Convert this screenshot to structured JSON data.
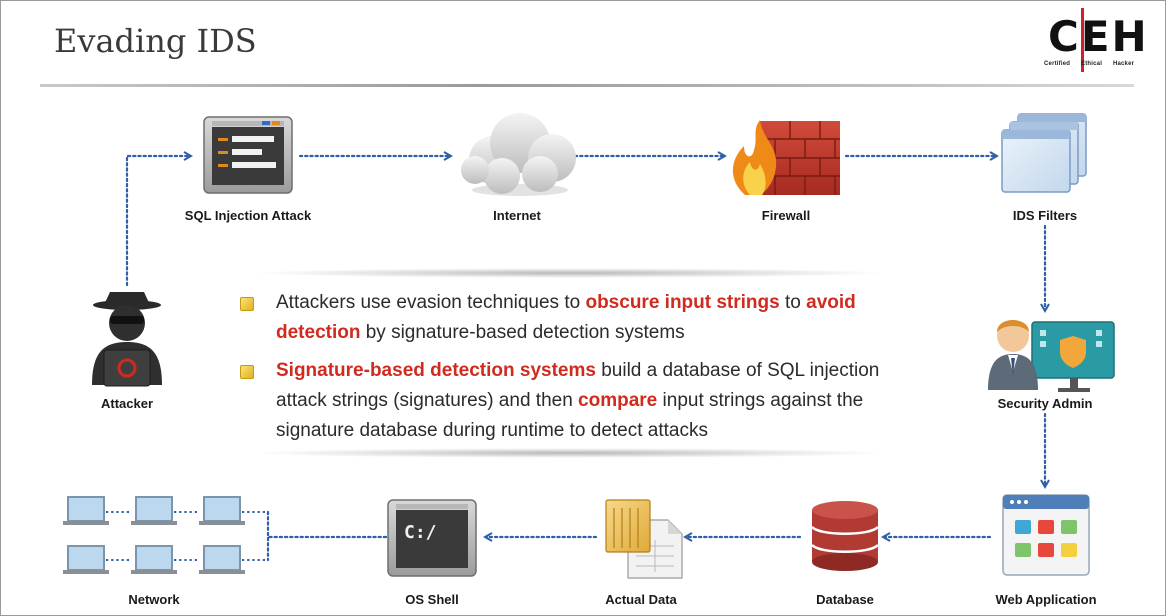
{
  "slide": {
    "title": "Evading IDS"
  },
  "logo": {
    "letters": "CEH",
    "tagline": "Certified Ethical Hacker"
  },
  "nodes": {
    "attacker": "Attacker",
    "sql_injection": "SQL Injection Attack",
    "internet": "Internet",
    "firewall": "Firewall",
    "ids_filters": "IDS Filters",
    "security_admin": "Security Admin",
    "web_application": "Web Application",
    "database": "Database",
    "actual_data": "Actual Data",
    "os_shell": "OS Shell",
    "network": "Network"
  },
  "os_shell_screen": "C:/",
  "bullets": [
    {
      "segments": [
        {
          "text": "Attackers use evasion techniques to ",
          "highlight": false
        },
        {
          "text": "obscure input strings",
          "highlight": true
        },
        {
          "text": " to ",
          "highlight": false
        },
        {
          "text": "avoid detection",
          "highlight": true
        },
        {
          "text": " by signature-based detection systems",
          "highlight": false
        }
      ]
    },
    {
      "segments": [
        {
          "text": "Signature-based detection systems",
          "highlight": true
        },
        {
          "text": " build a database of SQL injection attack strings (signatures) and then ",
          "highlight": false
        },
        {
          "text": "compare",
          "highlight": true
        },
        {
          "text": " input strings against the signature database during runtime to detect attacks",
          "highlight": false
        }
      ]
    }
  ],
  "colors": {
    "accent": "#d12a1f",
    "arrow": "#2f5fa8",
    "bullet": "#f2c632"
  }
}
